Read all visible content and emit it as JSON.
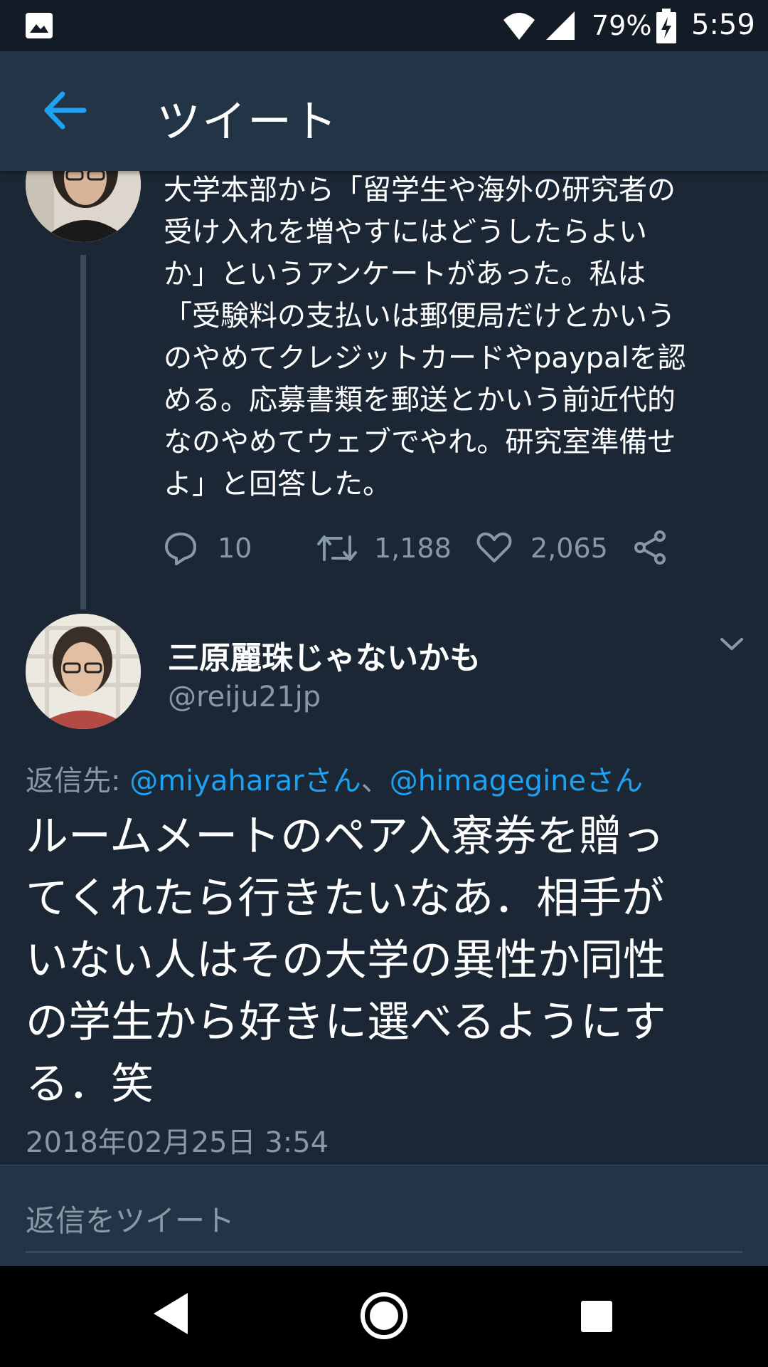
{
  "status_bar": {
    "battery": "79%",
    "time": "5:59",
    "icons": [
      "image-icon",
      "wifi-icon",
      "signal-icon",
      "battery-charging-icon"
    ]
  },
  "header": {
    "title": "ツイート",
    "back_icon": "arrow-left-icon"
  },
  "parent_tweet": {
    "lines": [
      "大学本部から「留学生や海外の研究者の",
      "受け入れを増やすにはどうしたらよい",
      "か」というアンケートがあった。私は",
      "「受験料の支払いは郵便局だけとかいう",
      "のやめてクレジットカードやpaypalを認",
      "める。応募書類を郵送とかいう前近代的",
      "なのやめてウェブでやれ。研究室準備せ",
      "よ」と回答した。"
    ],
    "replies": "10",
    "retweets": "1,188",
    "likes": "2,065"
  },
  "tweet": {
    "name": "三原麗珠じゃないかも",
    "handle": "@reiju21jp",
    "reply_prefix": "返信先: ",
    "reply_to_1": "@miyahararさん",
    "reply_separator": "、",
    "reply_to_2": "@himagegineさん",
    "lines": [
      "ルームメートのペア入寮券を贈っ",
      "てくれたら行きたいなあ．相手が",
      "いない人はその大学の異性か同性",
      "の学生から好きに選べるようにす",
      "る．笑"
    ],
    "timestamp": "2018年02月25日 3:54"
  },
  "reply_box": {
    "placeholder": "返信をツイート"
  },
  "colors": {
    "background": "#1b2735",
    "header": "#243447",
    "accent": "#1da1f2",
    "muted": "#8899a6"
  }
}
